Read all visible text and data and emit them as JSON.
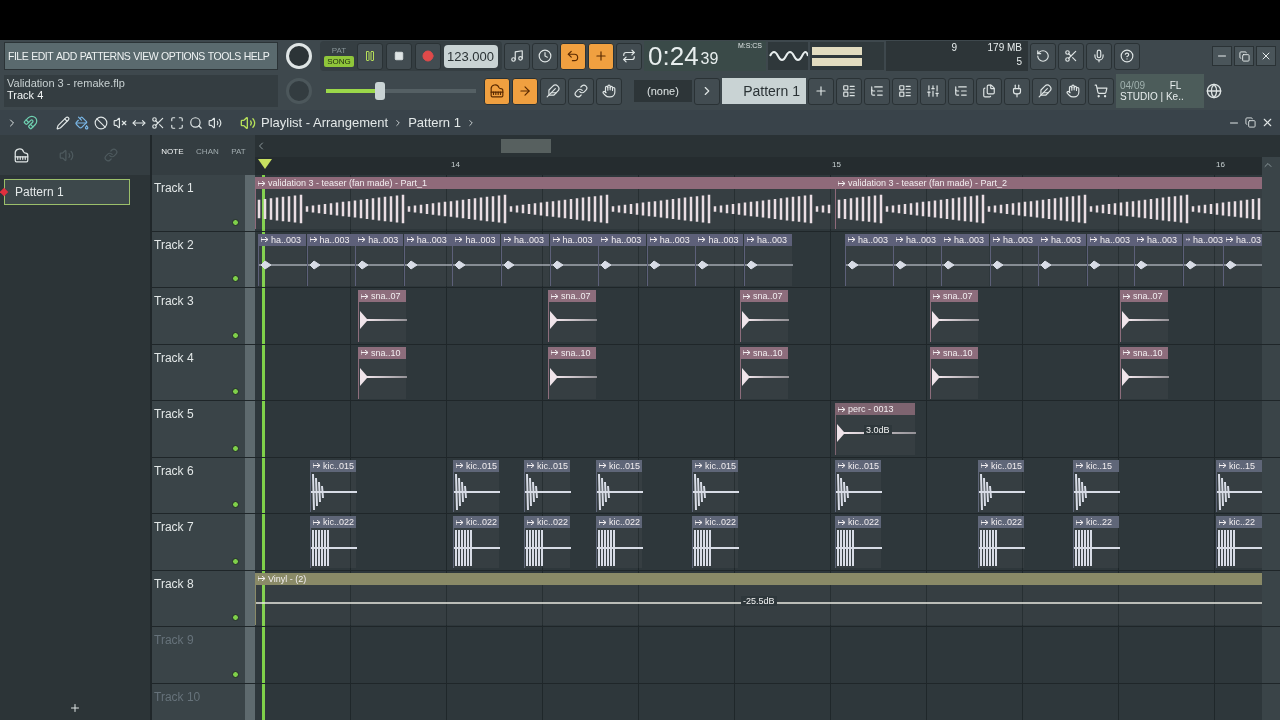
{
  "menu": [
    "FILE",
    "EDIT",
    "ADD",
    "PATTERNS",
    "VIEW",
    "OPTIONS",
    "TOOLS",
    "HELP"
  ],
  "project": {
    "file": "Validation 3 - remake.flp",
    "hint": "Track 4"
  },
  "modes": [
    {
      "label": "PAT",
      "selected": false
    },
    {
      "label": "SONG",
      "selected": true
    }
  ],
  "tempo": "123.000",
  "time": {
    "main": "0:24",
    "centis": "39",
    "unit": "M:S:CS"
  },
  "master_volume": {
    "level": 0.36
  },
  "monitor": {
    "cpu": "9",
    "memory": "179 MB",
    "polyphony": "5"
  },
  "toggles": [
    {
      "on": false
    },
    {
      "on": false
    },
    {
      "on": true
    },
    {
      "on": true
    },
    {
      "on": false
    }
  ],
  "toggles2": [
    {
      "on": true
    },
    {
      "on": true
    },
    {
      "on": false
    },
    {
      "on": false
    },
    {
      "on": false
    }
  ],
  "snap": "(none)",
  "pattern": "Pattern 1",
  "news": {
    "date": "04/09",
    "line1": "FL",
    "line2": "STUDIO | Ke.."
  },
  "playlist": {
    "title": "Playlist - Arrangement",
    "crumb": "Pattern 1",
    "picker_tabs": [
      {
        "label": "NOTE",
        "selected": true
      },
      {
        "label": "CHAN",
        "selected": false
      },
      {
        "label": "PAT",
        "selected": false
      }
    ],
    "patterns": [
      {
        "label": "Pattern 1",
        "selected": true
      }
    ],
    "ruler": [
      "14",
      "15",
      "16"
    ],
    "tracks": [
      {
        "name": "Track 1",
        "kind": "loop",
        "color": "#8f6a7a",
        "dimmed": false,
        "enabled": true,
        "clips": [
          {
            "label": "validation 3 - teaser (fan made) - Part_1"
          },
          {
            "label": "validation 3 - teaser (fan made) - Part_2"
          }
        ]
      },
      {
        "name": "Track 2",
        "kind": "hat",
        "color": "#5d6079",
        "dimmed": false,
        "enabled": true,
        "clips": [
          {
            "label": "ha..003"
          },
          {
            "label": "ha..003"
          },
          {
            "label": "ha..003"
          },
          {
            "label": "ha..003"
          },
          {
            "label": "ha..003"
          },
          {
            "label": "ha..003"
          },
          {
            "label": "ha..003"
          },
          {
            "label": "ha..003"
          },
          {
            "label": "ha..003"
          },
          {
            "label": "ha..003"
          },
          {
            "label": "ha..003"
          },
          {
            "label": "ha..003"
          },
          {
            "label": "ha..003"
          },
          {
            "label": "ha..003"
          },
          {
            "label": "ha..003"
          },
          {
            "label": "ha..003"
          },
          {
            "label": "ha..003"
          },
          {
            "label": "ha..003"
          },
          {
            "label": "ha..003"
          },
          {
            "label": "ha..03"
          }
        ]
      },
      {
        "name": "Track 3",
        "kind": "snare",
        "color": "#8d6d7c",
        "dimmed": false,
        "enabled": true,
        "clips": [
          {
            "label": "sna..07"
          },
          {
            "label": "sna..07"
          },
          {
            "label": "sna..07"
          },
          {
            "label": "sna..07"
          },
          {
            "label": "sna..07"
          }
        ]
      },
      {
        "name": "Track 4",
        "kind": "snare2",
        "color": "#8d6d7c",
        "dimmed": false,
        "enabled": true,
        "clips": [
          {
            "label": "sna..10"
          },
          {
            "label": "sna..10"
          },
          {
            "label": "sna..10"
          },
          {
            "label": "sna..10"
          },
          {
            "label": "sna..10"
          }
        ]
      },
      {
        "name": "Track 5",
        "kind": "perc",
        "color": "#7e6470",
        "dimmed": false,
        "enabled": true,
        "clips": [
          {
            "label": "perc - 0013",
            "gain": "3.0dB"
          }
        ]
      },
      {
        "name": "Track 6",
        "kind": "kick",
        "color": "#5f6678",
        "dimmed": false,
        "enabled": true,
        "clips": [
          {
            "label": "kic..015"
          },
          {
            "label": "kic..015"
          },
          {
            "label": "kic..015"
          },
          {
            "label": "kic..015"
          },
          {
            "label": "kic..015"
          },
          {
            "label": "kic..015"
          },
          {
            "label": "kic..015"
          },
          {
            "label": "kic..15"
          },
          {
            "label": "kic..15"
          }
        ]
      },
      {
        "name": "Track 7",
        "kind": "kick2",
        "color": "#5f6678",
        "dimmed": false,
        "enabled": true,
        "clips": [
          {
            "label": "kic..022"
          },
          {
            "label": "kic..022"
          },
          {
            "label": "kic..022"
          },
          {
            "label": "kic..022"
          },
          {
            "label": "kic..022"
          },
          {
            "label": "kic..022"
          },
          {
            "label": "kic..022"
          },
          {
            "label": "kic..22"
          },
          {
            "label": "kic..22"
          }
        ]
      },
      {
        "name": "Track 8",
        "kind": "flat",
        "color": "#8a8a67",
        "dimmed": false,
        "enabled": true,
        "clips": [
          {
            "label": "Vinyl - (2)",
            "gain": "-25.5dB"
          }
        ]
      },
      {
        "name": "Track 9",
        "kind": "empty",
        "dimmed": true,
        "enabled": true
      },
      {
        "name": "Track 10",
        "kind": "empty",
        "dimmed": true
      }
    ]
  }
}
